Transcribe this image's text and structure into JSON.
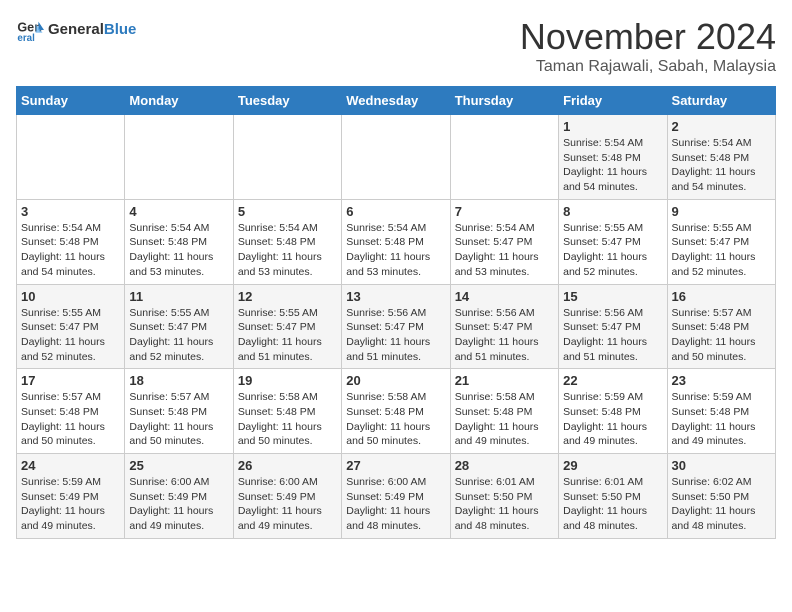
{
  "logo": {
    "text_general": "General",
    "text_blue": "Blue"
  },
  "header": {
    "month": "November 2024",
    "location": "Taman Rajawali, Sabah, Malaysia"
  },
  "weekdays": [
    "Sunday",
    "Monday",
    "Tuesday",
    "Wednesday",
    "Thursday",
    "Friday",
    "Saturday"
  ],
  "weeks": [
    [
      {
        "day": "",
        "info": ""
      },
      {
        "day": "",
        "info": ""
      },
      {
        "day": "",
        "info": ""
      },
      {
        "day": "",
        "info": ""
      },
      {
        "day": "",
        "info": ""
      },
      {
        "day": "1",
        "info": "Sunrise: 5:54 AM\nSunset: 5:48 PM\nDaylight: 11 hours and 54 minutes."
      },
      {
        "day": "2",
        "info": "Sunrise: 5:54 AM\nSunset: 5:48 PM\nDaylight: 11 hours and 54 minutes."
      }
    ],
    [
      {
        "day": "3",
        "info": "Sunrise: 5:54 AM\nSunset: 5:48 PM\nDaylight: 11 hours and 54 minutes."
      },
      {
        "day": "4",
        "info": "Sunrise: 5:54 AM\nSunset: 5:48 PM\nDaylight: 11 hours and 53 minutes."
      },
      {
        "day": "5",
        "info": "Sunrise: 5:54 AM\nSunset: 5:48 PM\nDaylight: 11 hours and 53 minutes."
      },
      {
        "day": "6",
        "info": "Sunrise: 5:54 AM\nSunset: 5:48 PM\nDaylight: 11 hours and 53 minutes."
      },
      {
        "day": "7",
        "info": "Sunrise: 5:54 AM\nSunset: 5:47 PM\nDaylight: 11 hours and 53 minutes."
      },
      {
        "day": "8",
        "info": "Sunrise: 5:55 AM\nSunset: 5:47 PM\nDaylight: 11 hours and 52 minutes."
      },
      {
        "day": "9",
        "info": "Sunrise: 5:55 AM\nSunset: 5:47 PM\nDaylight: 11 hours and 52 minutes."
      }
    ],
    [
      {
        "day": "10",
        "info": "Sunrise: 5:55 AM\nSunset: 5:47 PM\nDaylight: 11 hours and 52 minutes."
      },
      {
        "day": "11",
        "info": "Sunrise: 5:55 AM\nSunset: 5:47 PM\nDaylight: 11 hours and 52 minutes."
      },
      {
        "day": "12",
        "info": "Sunrise: 5:55 AM\nSunset: 5:47 PM\nDaylight: 11 hours and 51 minutes."
      },
      {
        "day": "13",
        "info": "Sunrise: 5:56 AM\nSunset: 5:47 PM\nDaylight: 11 hours and 51 minutes."
      },
      {
        "day": "14",
        "info": "Sunrise: 5:56 AM\nSunset: 5:47 PM\nDaylight: 11 hours and 51 minutes."
      },
      {
        "day": "15",
        "info": "Sunrise: 5:56 AM\nSunset: 5:47 PM\nDaylight: 11 hours and 51 minutes."
      },
      {
        "day": "16",
        "info": "Sunrise: 5:57 AM\nSunset: 5:48 PM\nDaylight: 11 hours and 50 minutes."
      }
    ],
    [
      {
        "day": "17",
        "info": "Sunrise: 5:57 AM\nSunset: 5:48 PM\nDaylight: 11 hours and 50 minutes."
      },
      {
        "day": "18",
        "info": "Sunrise: 5:57 AM\nSunset: 5:48 PM\nDaylight: 11 hours and 50 minutes."
      },
      {
        "day": "19",
        "info": "Sunrise: 5:58 AM\nSunset: 5:48 PM\nDaylight: 11 hours and 50 minutes."
      },
      {
        "day": "20",
        "info": "Sunrise: 5:58 AM\nSunset: 5:48 PM\nDaylight: 11 hours and 50 minutes."
      },
      {
        "day": "21",
        "info": "Sunrise: 5:58 AM\nSunset: 5:48 PM\nDaylight: 11 hours and 49 minutes."
      },
      {
        "day": "22",
        "info": "Sunrise: 5:59 AM\nSunset: 5:48 PM\nDaylight: 11 hours and 49 minutes."
      },
      {
        "day": "23",
        "info": "Sunrise: 5:59 AM\nSunset: 5:48 PM\nDaylight: 11 hours and 49 minutes."
      }
    ],
    [
      {
        "day": "24",
        "info": "Sunrise: 5:59 AM\nSunset: 5:49 PM\nDaylight: 11 hours and 49 minutes."
      },
      {
        "day": "25",
        "info": "Sunrise: 6:00 AM\nSunset: 5:49 PM\nDaylight: 11 hours and 49 minutes."
      },
      {
        "day": "26",
        "info": "Sunrise: 6:00 AM\nSunset: 5:49 PM\nDaylight: 11 hours and 49 minutes."
      },
      {
        "day": "27",
        "info": "Sunrise: 6:00 AM\nSunset: 5:49 PM\nDaylight: 11 hours and 48 minutes."
      },
      {
        "day": "28",
        "info": "Sunrise: 6:01 AM\nSunset: 5:50 PM\nDaylight: 11 hours and 48 minutes."
      },
      {
        "day": "29",
        "info": "Sunrise: 6:01 AM\nSunset: 5:50 PM\nDaylight: 11 hours and 48 minutes."
      },
      {
        "day": "30",
        "info": "Sunrise: 6:02 AM\nSunset: 5:50 PM\nDaylight: 11 hours and 48 minutes."
      }
    ]
  ]
}
